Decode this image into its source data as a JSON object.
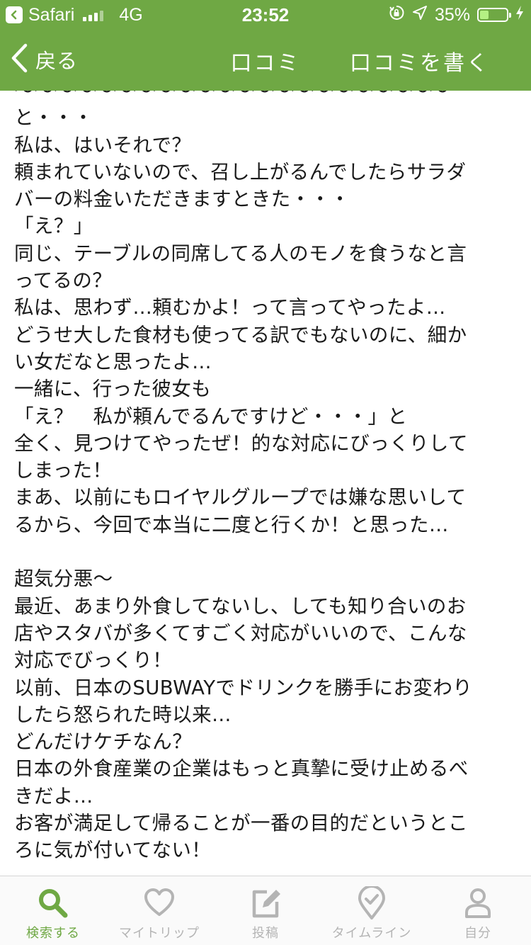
{
  "status_bar": {
    "carrier": "Safari",
    "network": "4G",
    "time": "23:52",
    "battery_percent": "35%",
    "battery_level": 0.35,
    "icons": [
      "back-to-app-icon",
      "signal-icon",
      "rotation-lock-icon",
      "location-icon",
      "battery-icon",
      "charging-icon"
    ]
  },
  "nav": {
    "back_label": "戻る",
    "title": "口コミ",
    "write_label": "口コミを書く",
    "color": "#6fa844"
  },
  "review": {
    "lines": [
      "〜〜〜〜〜〜〜〜〜〜〜〜〜〜〜〜〜〜〜〜〜〜",
      "と・・・",
      "私は、はいそれで？",
      "頼まれていないので、召し上がるんでしたらサラダ",
      "バーの料金いただきますときた・・・",
      "「え？」",
      "同じ、テーブルの同席してる人のモノを食うなと言",
      "ってるの？",
      "私は、思わず…頼むかよ！って言ってやったよ…",
      "どうせ大した食材も使ってる訳でもないのに、細か",
      "い女だなと思ったよ…",
      "一緒に、行った彼女も",
      "「え？　私が頼んでるんですけど・・・」と",
      "全く、見つけてやったぜ！的な対応にびっくりして",
      "しまった！",
      "まあ、以前にもロイヤルグループでは嫌な思いして",
      "るから、今回で本当に二度と行くか！と思った…",
      "",
      "超気分悪〜",
      "最近、あまり外食してないし、しても知り合いのお",
      "店やスタバが多くてすごく対応がいいので、こんな",
      "対応でびっくり！",
      "以前、日本のSUBWAYでドリンクを勝手にお変わり",
      "したら怒られた時以来…",
      "どんだけケチなん？",
      "日本の外食産業の企業はもっと真摯に受け止めるべ",
      "きだよ…",
      "お客が満足して帰ることが一番の目的だというとこ",
      "ろに気が付いてない！"
    ]
  },
  "tabs": [
    {
      "label": "検索する",
      "icon": "search-icon",
      "active": true
    },
    {
      "label": "マイトリップ",
      "icon": "heart-icon",
      "active": false
    },
    {
      "label": "投稿",
      "icon": "edit-icon",
      "active": false
    },
    {
      "label": "タイムライン",
      "icon": "map-pin-check-icon",
      "active": false
    },
    {
      "label": "自分",
      "icon": "person-icon",
      "active": false
    }
  ],
  "colors": {
    "accent": "#6fa844",
    "tab_inactive": "#b4b4b4",
    "text": "#1a1a1a"
  }
}
